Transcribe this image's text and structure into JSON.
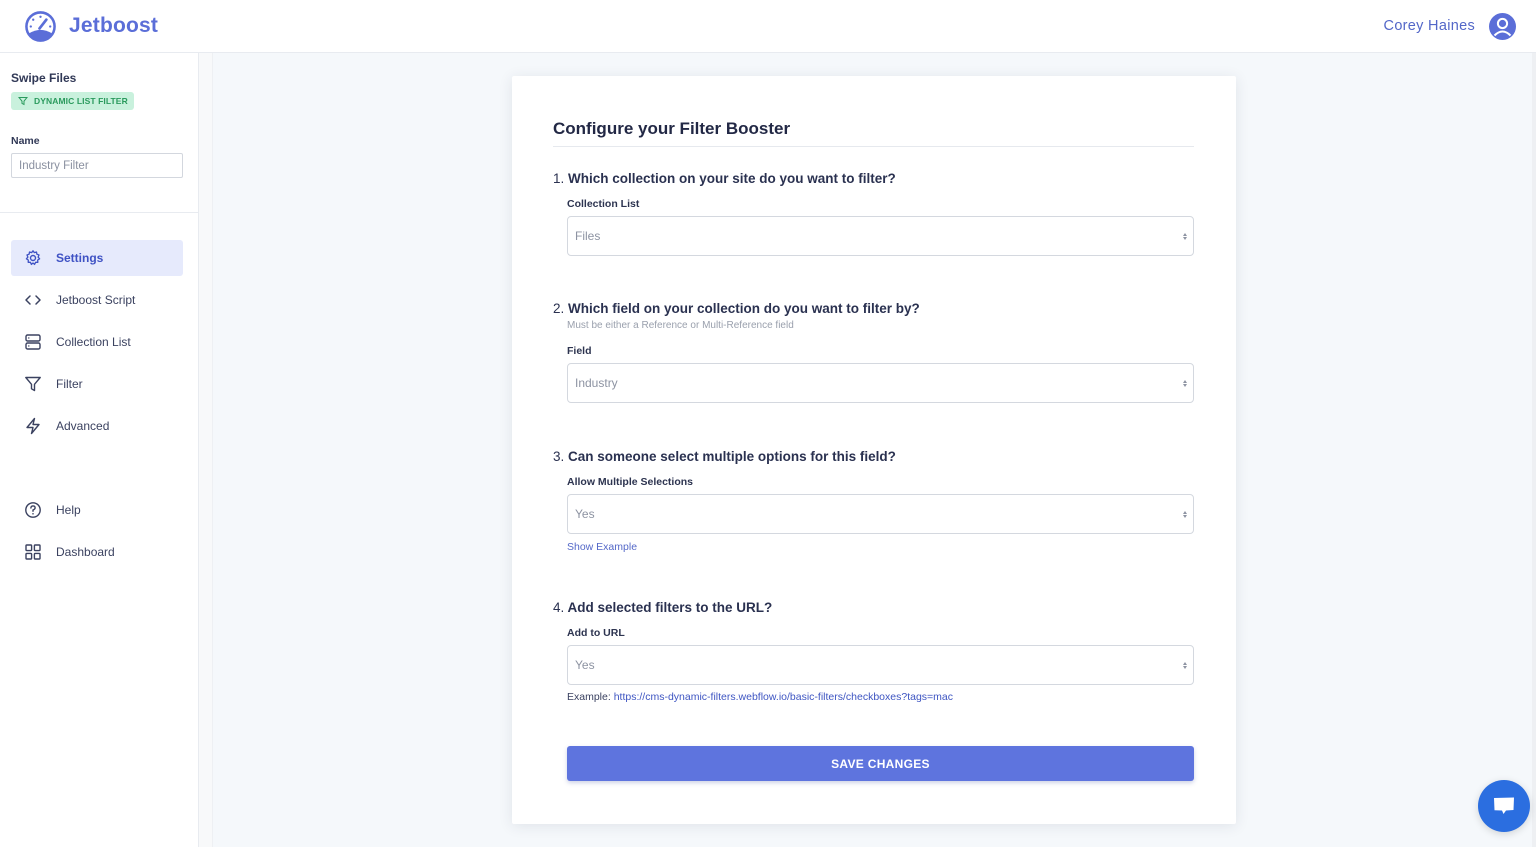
{
  "header": {
    "brand": "Jetboost",
    "user_name": "Corey Haines"
  },
  "sidebar": {
    "project_name": "Swipe Files",
    "badge": "DYNAMIC LIST FILTER",
    "name_label": "Name",
    "name_value": "Industry Filter",
    "nav": [
      {
        "label": "Settings",
        "icon": "gear-icon",
        "active": true
      },
      {
        "label": "Jetboost Script",
        "icon": "code-icon",
        "active": false
      },
      {
        "label": "Collection List",
        "icon": "server-icon",
        "active": false
      },
      {
        "label": "Filter",
        "icon": "filter-icon",
        "active": false
      },
      {
        "label": "Advanced",
        "icon": "lightning-icon",
        "active": false
      }
    ],
    "nav_secondary": [
      {
        "label": "Help",
        "icon": "help-circle-icon"
      },
      {
        "label": "Dashboard",
        "icon": "grid-icon"
      }
    ]
  },
  "card": {
    "title": "Configure your Filter Booster",
    "questions": [
      {
        "number": "1.",
        "title": "Which collection on your site do you want to filter?",
        "field_label": "Collection List",
        "value": "Files"
      },
      {
        "number": "2.",
        "title": "Which field on your collection do you want to filter by?",
        "help": "Must be either a Reference or Multi-Reference field",
        "field_label": "Field",
        "value": "Industry"
      },
      {
        "number": "3.",
        "title": "Can someone select multiple options for this field?",
        "field_label": "Allow Multiple Selections",
        "value": "Yes",
        "link": "Show Example"
      },
      {
        "number": "4.",
        "title": "Add selected filters to the URL?",
        "field_label": "Add to URL",
        "value": "Yes",
        "example_prefix": "Example: ",
        "example_url": "https://cms-dynamic-filters.webflow.io/basic-filters/checkboxes?tags=mac"
      }
    ],
    "save_label": "SAVE CHANGES"
  },
  "colors": {
    "brand": "#5b6ed8",
    "badge_bg": "#c9f1dd",
    "badge_text": "#2a9a5d",
    "active_nav_bg": "#e6eafc",
    "save_button": "#5e74de",
    "chat_bubble": "#2b6ee0"
  }
}
